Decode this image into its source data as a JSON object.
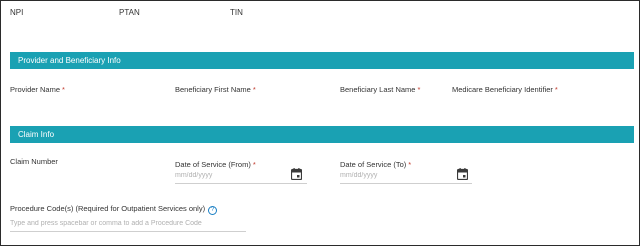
{
  "header": {
    "npi_label": "NPI",
    "ptan_label": "PTAN",
    "tin_label": "TIN"
  },
  "provider_section": {
    "title": "Provider and Beneficiary Info",
    "fields": {
      "provider_name": "Provider Name",
      "beneficiary_first_name": "Beneficiary First Name",
      "beneficiary_last_name": "Beneficiary Last Name",
      "medicare_beneficiary_identifier": "Medicare Beneficiary Identifier"
    },
    "required_marker": "*"
  },
  "claim_section": {
    "title": "Claim Info",
    "claim_number_label": "Claim Number",
    "date_from_label": "Date of Service (From)",
    "date_to_label": "Date of Service (To)",
    "date_placeholder": "mm/dd/yyyy",
    "procedure_codes_label": "Procedure Code(s) (Required for Outpatient Services only)",
    "procedure_codes_placeholder": "Type and press spacebar or comma to add a Procedure Code",
    "help_glyph": "?",
    "required_marker": "*"
  },
  "icons": {
    "calendar": "calendar-icon",
    "help": "help-icon"
  },
  "colors": {
    "section_bar": "#1aa1b3",
    "required": "#c0392b",
    "help": "#1a7fc4"
  }
}
